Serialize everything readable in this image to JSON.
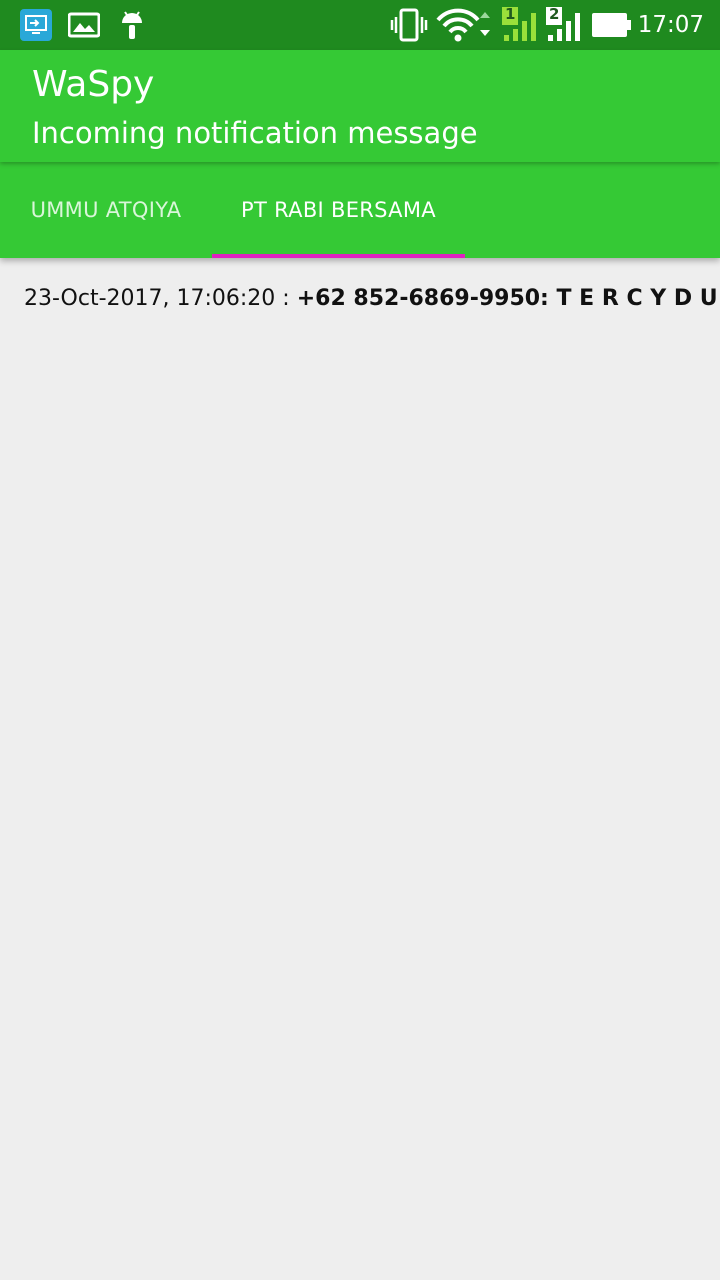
{
  "status_bar": {
    "time": "17:07",
    "sim1_label": "1",
    "sim2_label": "2",
    "icons": [
      "screen-cast-icon",
      "image-icon",
      "android-icon",
      "vibrate-icon",
      "wifi-icon",
      "signal-sim1-icon",
      "signal-sim2-icon",
      "battery-icon"
    ]
  },
  "app_bar": {
    "title": "WaSpy",
    "subtitle": "Incoming notification message"
  },
  "tabs": [
    {
      "label": "UMMU ATQIYA",
      "selected": false
    },
    {
      "label": "PT RABI BERSAMA",
      "selected": true
    }
  ],
  "messages": [
    {
      "timestamp": "23-Oct-2017, 17:06:20 : ",
      "sender": "+62 852-6869-9950: ",
      "text": "T E R C Y D U K"
    }
  ],
  "colors": {
    "status_bar": "#1f8a1f",
    "app_bar": "#35c935",
    "tab_indicator": "#e020c0",
    "background": "#eeeeee"
  }
}
